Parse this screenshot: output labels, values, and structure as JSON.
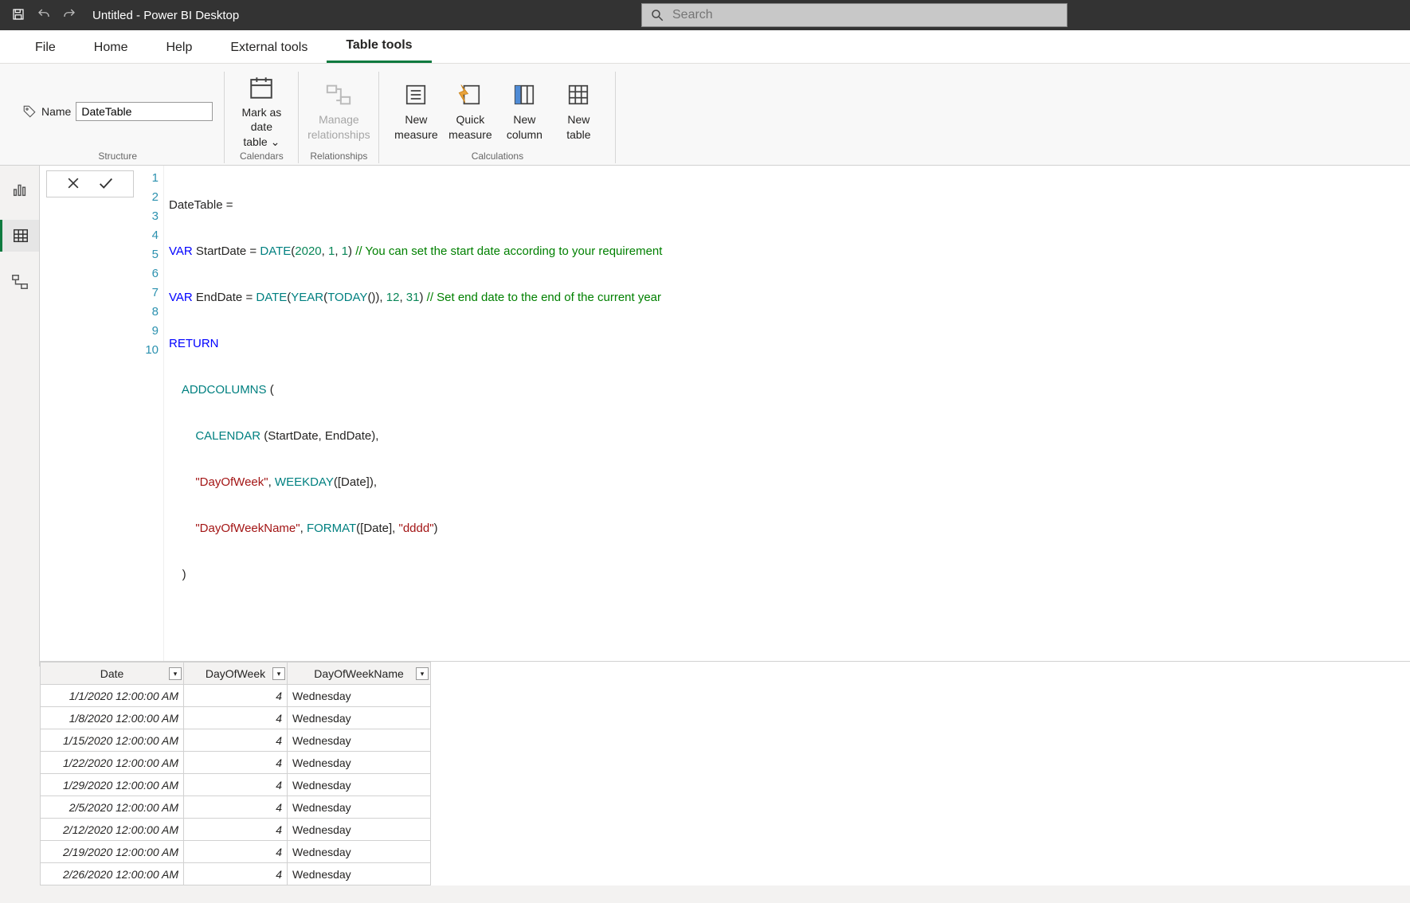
{
  "title": "Untitled - Power BI Desktop",
  "search": {
    "placeholder": "Search"
  },
  "menus": {
    "file": "File",
    "home": "Home",
    "help": "Help",
    "external": "External tools",
    "tabletools": "Table tools"
  },
  "ribbon": {
    "name_label": "Name",
    "name_value": "DateTable",
    "mark_date": "Mark as date\ntable ⌄",
    "manage_rel": "Manage\nrelationships",
    "new_measure": "New\nmeasure",
    "quick_measure": "Quick\nmeasure",
    "new_column": "New\ncolumn",
    "new_table": "New\ntable",
    "grp_structure": "Structure",
    "grp_calendars": "Calendars",
    "grp_relationships": "Relationships",
    "grp_calculations": "Calculations"
  },
  "formula": {
    "lines": [
      "1",
      "2",
      "3",
      "4",
      "5",
      "6",
      "7",
      "8",
      "9",
      "10"
    ]
  },
  "table": {
    "headers": [
      "Date",
      "DayOfWeek",
      "DayOfWeekName"
    ],
    "rows": [
      {
        "date": "1/1/2020 12:00:00 AM",
        "dow": "4",
        "down": "Wednesday"
      },
      {
        "date": "1/8/2020 12:00:00 AM",
        "dow": "4",
        "down": "Wednesday"
      },
      {
        "date": "1/15/2020 12:00:00 AM",
        "dow": "4",
        "down": "Wednesday"
      },
      {
        "date": "1/22/2020 12:00:00 AM",
        "dow": "4",
        "down": "Wednesday"
      },
      {
        "date": "1/29/2020 12:00:00 AM",
        "dow": "4",
        "down": "Wednesday"
      },
      {
        "date": "2/5/2020 12:00:00 AM",
        "dow": "4",
        "down": "Wednesday"
      },
      {
        "date": "2/12/2020 12:00:00 AM",
        "dow": "4",
        "down": "Wednesday"
      },
      {
        "date": "2/19/2020 12:00:00 AM",
        "dow": "4",
        "down": "Wednesday"
      },
      {
        "date": "2/26/2020 12:00:00 AM",
        "dow": "4",
        "down": "Wednesday"
      }
    ]
  },
  "dax": {
    "l1_a": "DateTable =",
    "l2_var": "VAR",
    "l2_name": " StartDate = ",
    "l2_func": "DATE",
    "l2_p": "(",
    "l2_n1": "2020",
    "l2_c1": ", ",
    "l2_n2": "1",
    "l2_c2": ", ",
    "l2_n3": "1",
    "l2_p2": ") ",
    "l2_com": "// You can set the start date according to your requirement",
    "l3_var": "VAR",
    "l3_name": " EndDate = ",
    "l3_f1": "DATE",
    "l3_p1": "(",
    "l3_f2": "YEAR",
    "l3_p2": "(",
    "l3_f3": "TODAY",
    "l3_p3": "()), ",
    "l3_n1": "12",
    "l3_c": ", ",
    "l3_n2": "31",
    "l3_p4": ") ",
    "l3_com": "// Set end date to the end of the current year",
    "l4": "RETURN",
    "l5_pad": "    ",
    "l5_f": "ADDCOLUMNS",
    "l5_p": " (",
    "l6_pad": "        ",
    "l6_f": "CALENDAR",
    "l6_rest": " (StartDate, EndDate),",
    "l7_pad": "        ",
    "l7_s": "\"DayOfWeek\"",
    "l7_c": ", ",
    "l7_f": "WEEKDAY",
    "l7_rest": "([Date]),",
    "l8_pad": "        ",
    "l8_s": "\"DayOfWeekName\"",
    "l8_c": ", ",
    "l8_f": "FORMAT",
    "l8_p": "([Date], ",
    "l8_s2": "\"dddd\"",
    "l8_p2": ")",
    "l9": "    )"
  }
}
